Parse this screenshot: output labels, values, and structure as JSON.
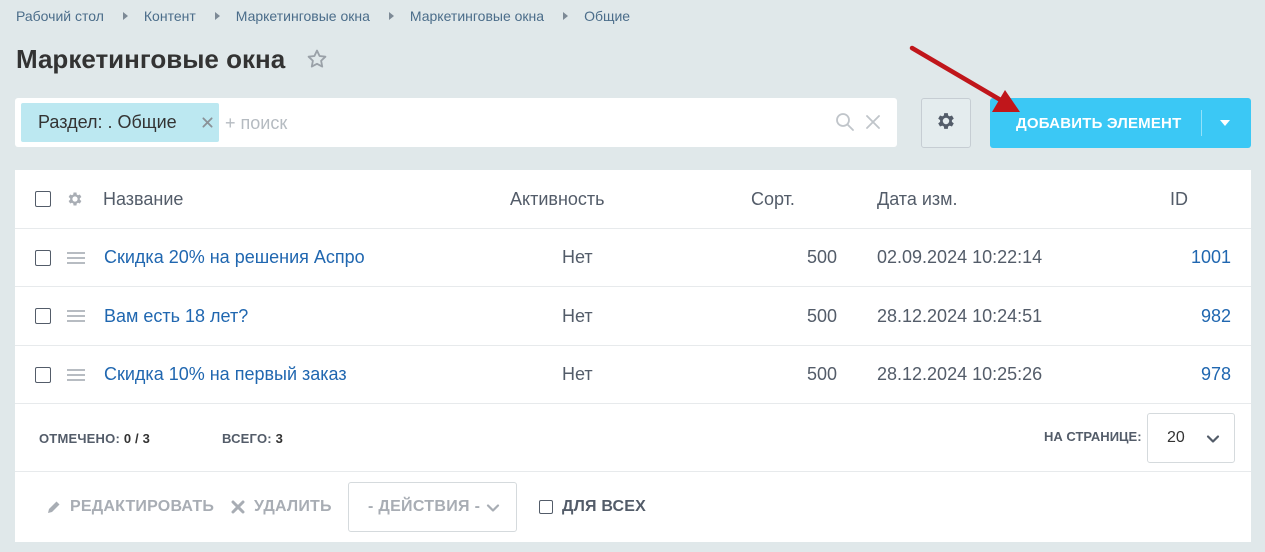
{
  "breadcrumb": [
    "Рабочий стол",
    "Контент",
    "Маркетинговые окна",
    "Маркетинговые окна",
    "Общие"
  ],
  "page": {
    "title": "Маркетинговые окна"
  },
  "filter": {
    "tag_label": "Раздел: . Общие",
    "search_placeholder": "+ поиск"
  },
  "toolbar": {
    "add_label": "ДОБАВИТЬ ЭЛЕМЕНТ"
  },
  "table": {
    "columns": {
      "name": "Название",
      "active": "Активность",
      "sort": "Сорт.",
      "date": "Дата изм.",
      "id": "ID"
    },
    "rows": [
      {
        "name": "Скидка 20% на решения Аспро",
        "active": "Нет",
        "sort": "500",
        "date": "02.09.2024 10:22:14",
        "id": "1001"
      },
      {
        "name": "Вам есть 18 лет?",
        "active": "Нет",
        "sort": "500",
        "date": "28.12.2024 10:24:51",
        "id": "982"
      },
      {
        "name": "Скидка 10% на первый заказ",
        "active": "Нет",
        "sort": "500",
        "date": "28.12.2024 10:25:26",
        "id": "978"
      }
    ]
  },
  "footer": {
    "selected_label": "ОТМЕЧЕНО:",
    "selected_value": "0 / 3",
    "total_label": "ВСЕГО:",
    "total_value": "3",
    "per_page_label": "НА СТРАНИЦЕ:",
    "per_page_value": "20"
  },
  "actions": {
    "edit_label": "РЕДАКТИРОВАТЬ",
    "delete_label": "УДАЛИТЬ",
    "select_value": "- ДЕЙСТВИЯ -",
    "for_all_label": "ДЛЯ ВСЕХ"
  },
  "colors": {
    "accent": "#3bc8f5",
    "link": "#2067b0",
    "tag": "#bce8f1",
    "arrow": "#c0161b"
  }
}
